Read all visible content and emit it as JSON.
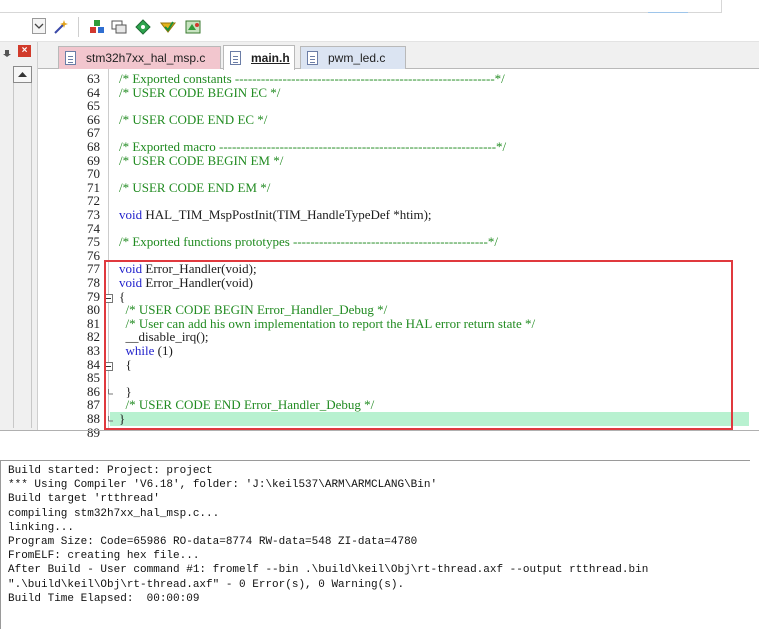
{
  "tabs": [
    {
      "label": "stm32h7xx_hal_msp.c",
      "state": "modified"
    },
    {
      "label": "main.h",
      "state": "active"
    },
    {
      "label": "pwm_led.c",
      "state": "inactive"
    }
  ],
  "editor": {
    "lines": [
      {
        "n": "63",
        "parts": [
          {
            "t": "/* Exported constants ------------------------------------------------------------*/",
            "c": "comment"
          }
        ]
      },
      {
        "n": "64",
        "parts": [
          {
            "t": "/* USER CODE BEGIN EC */",
            "c": "comment"
          }
        ]
      },
      {
        "n": "65",
        "parts": []
      },
      {
        "n": "66",
        "parts": [
          {
            "t": "/* USER CODE END EC */",
            "c": "comment"
          }
        ]
      },
      {
        "n": "67",
        "parts": []
      },
      {
        "n": "68",
        "parts": [
          {
            "t": "/* Exported macro ----------------------------------------------------------------*/",
            "c": "comment"
          }
        ]
      },
      {
        "n": "69",
        "parts": [
          {
            "t": "/* USER CODE BEGIN EM */",
            "c": "comment"
          }
        ]
      },
      {
        "n": "70",
        "parts": []
      },
      {
        "n": "71",
        "parts": [
          {
            "t": "/* USER CODE END EM */",
            "c": "comment"
          }
        ]
      },
      {
        "n": "72",
        "parts": []
      },
      {
        "n": "73",
        "parts": [
          {
            "t": "void",
            "c": "kw"
          },
          {
            "t": " HAL_TIM_MspPostInit(TIM_HandleTypeDef *htim);",
            "c": "plain"
          }
        ]
      },
      {
        "n": "74",
        "parts": []
      },
      {
        "n": "75",
        "parts": [
          {
            "t": "/* Exported functions prototypes ---------------------------------------------*/",
            "c": "comment"
          }
        ]
      },
      {
        "n": "76",
        "parts": []
      },
      {
        "n": "77",
        "parts": [
          {
            "t": "void",
            "c": "kw"
          },
          {
            "t": " Error_Handler(void);",
            "c": "plain"
          }
        ]
      },
      {
        "n": "78",
        "parts": [
          {
            "t": "void",
            "c": "kw"
          },
          {
            "t": " Error_Handler(void)",
            "c": "plain"
          }
        ]
      },
      {
        "n": "79",
        "parts": [
          {
            "t": "{",
            "c": "plain"
          }
        ],
        "fold": "open"
      },
      {
        "n": "80",
        "parts": [
          {
            "t": "  /* USER CODE BEGIN Error_Handler_Debug */",
            "c": "comment"
          }
        ]
      },
      {
        "n": "81",
        "parts": [
          {
            "t": "  /* User can add his own implementation to report the HAL error return state */",
            "c": "comment"
          }
        ]
      },
      {
        "n": "82",
        "parts": [
          {
            "t": "  __disable_irq();",
            "c": "plain"
          }
        ]
      },
      {
        "n": "83",
        "parts": [
          {
            "t": "  ",
            "c": "plain"
          },
          {
            "t": "while",
            "c": "kw"
          },
          {
            "t": " (1)",
            "c": "plain"
          }
        ]
      },
      {
        "n": "84",
        "parts": [
          {
            "t": "  {",
            "c": "plain"
          }
        ],
        "fold": "open"
      },
      {
        "n": "85",
        "parts": []
      },
      {
        "n": "86",
        "parts": [
          {
            "t": "  }",
            "c": "plain"
          }
        ],
        "fold": "end"
      },
      {
        "n": "87",
        "parts": [
          {
            "t": "  /* USER CODE END Error_Handler_Debug */",
            "c": "comment"
          }
        ]
      },
      {
        "n": "88",
        "parts": [
          {
            "t": "}",
            "c": "plain"
          }
        ],
        "fold": "end",
        "highlight": true
      },
      {
        "n": "89",
        "parts": []
      }
    ]
  },
  "build_output": {
    "lines": [
      "Build started: Project: project",
      "*** Using Compiler 'V6.18', folder: 'J:\\keil537\\ARM\\ARMCLANG\\Bin'",
      "Build target 'rtthread'",
      "compiling stm32h7xx_hal_msp.c...",
      "linking...",
      "Program Size: Code=65986 RO-data=8774 RW-data=548 ZI-data=4780",
      "FromELF: creating hex file...",
      "After Build - User command #1: fromelf --bin .\\build\\keil\\Obj\\rt-thread.axf --output rtthread.bin",
      "\".\\build\\keil\\Obj\\rt-thread.axf\" - 0 Error(s), 0 Warning(s).",
      "Build Time Elapsed:  00:00:09"
    ]
  },
  "toolbar_icons": [
    "dropdown-icon",
    "wand-icon",
    "build-target-icon",
    "window-layout-icon",
    "green-diamond-icon",
    "debug-arrow-icon",
    "translate-icon"
  ],
  "colors": {
    "comment": "#218b21",
    "keyword": "#2222cc",
    "current_line": "#b8f1d0",
    "annotation_box": "#e0393e"
  }
}
